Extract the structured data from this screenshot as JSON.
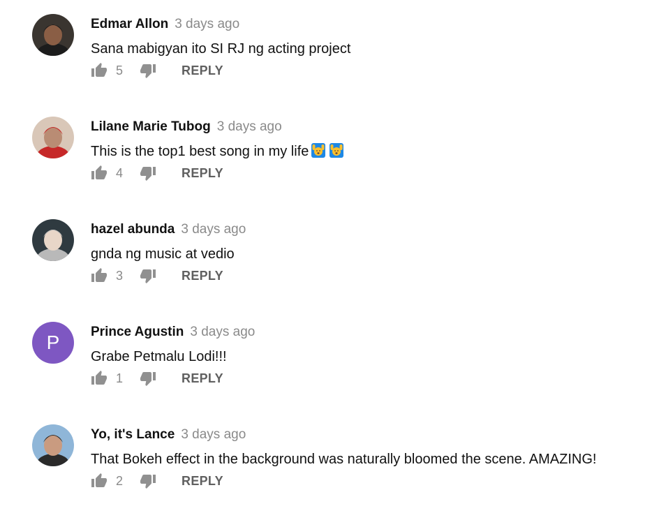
{
  "comments": [
    {
      "author": "Edmar Allon",
      "time": "3 days ago",
      "text": "Sana mabigyan ito SI RJ ng acting project",
      "likes": "5",
      "reply_label": "REPLY",
      "avatar": {
        "type": "photo",
        "bg": "#3a3530",
        "skin": "#8a5e45",
        "accent": "#1c1c1c"
      },
      "emoji_count": 0
    },
    {
      "author": "Lilane Marie Tubog",
      "time": "3 days ago",
      "text": "This is the top1 best song in my life",
      "likes": "4",
      "reply_label": "REPLY",
      "avatar": {
        "type": "photo",
        "bg": "#d9c7b8",
        "skin": "#b98c74",
        "accent": "#c62828"
      },
      "emoji_count": 2,
      "emoji_name": "raising-hands-emoji"
    },
    {
      "author": "hazel abunda",
      "time": "3 days ago",
      "text": "gnda ng music at vedio",
      "likes": "3",
      "reply_label": "REPLY",
      "avatar": {
        "type": "photo",
        "bg": "#2f3a40",
        "skin": "#e8d6c8",
        "accent": "#b9b9b9"
      },
      "emoji_count": 0
    },
    {
      "author": "Prince Agustin",
      "time": "3 days ago",
      "text": "Grabe Petmalu Lodi!!!",
      "likes": "1",
      "reply_label": "REPLY",
      "avatar": {
        "type": "letter",
        "letter": "P",
        "bg": "#7e57c2"
      },
      "emoji_count": 0
    },
    {
      "author": "Yo, it's Lance",
      "time": "3 days ago",
      "text": "That Bokeh effect in the background was naturally bloomed the scene. AMAZING!",
      "likes": "2",
      "reply_label": "REPLY",
      "avatar": {
        "type": "photo",
        "bg": "#8fb6d8",
        "skin": "#c99b80",
        "accent": "#2a2a2a"
      },
      "emoji_count": 0
    }
  ],
  "colors": {
    "author": "#111111",
    "timestamp": "#8a8a8a",
    "icon": "#909090",
    "reply": "#606060"
  },
  "icons": {
    "like": "thumbs-up-icon",
    "dislike": "thumbs-down-icon"
  }
}
